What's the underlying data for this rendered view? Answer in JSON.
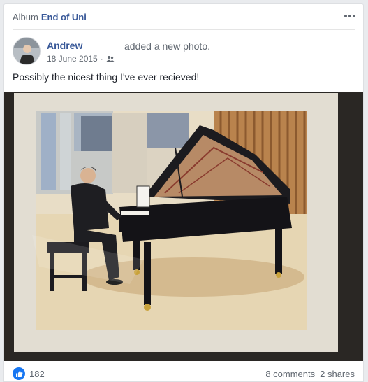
{
  "album": {
    "prefix": "Album",
    "name": "End of Uni"
  },
  "post": {
    "author": "Andrew",
    "action": "added a new photo.",
    "date": "18 June 2015",
    "separator": "·",
    "audience_icon": "friends-icon",
    "text": "Possibly the nicest thing I've ever recieved!",
    "photo_description": "framed watercolour painting of a man playing a black grand piano"
  },
  "reactions": {
    "count": "182",
    "icon": "like-icon",
    "color": "#1877f2"
  },
  "stats": {
    "comments": "8 comments",
    "shares": "2 shares"
  },
  "colors": {
    "link": "#385898",
    "muted": "#606770",
    "text": "#1d2129",
    "background": "#e9ebee"
  }
}
